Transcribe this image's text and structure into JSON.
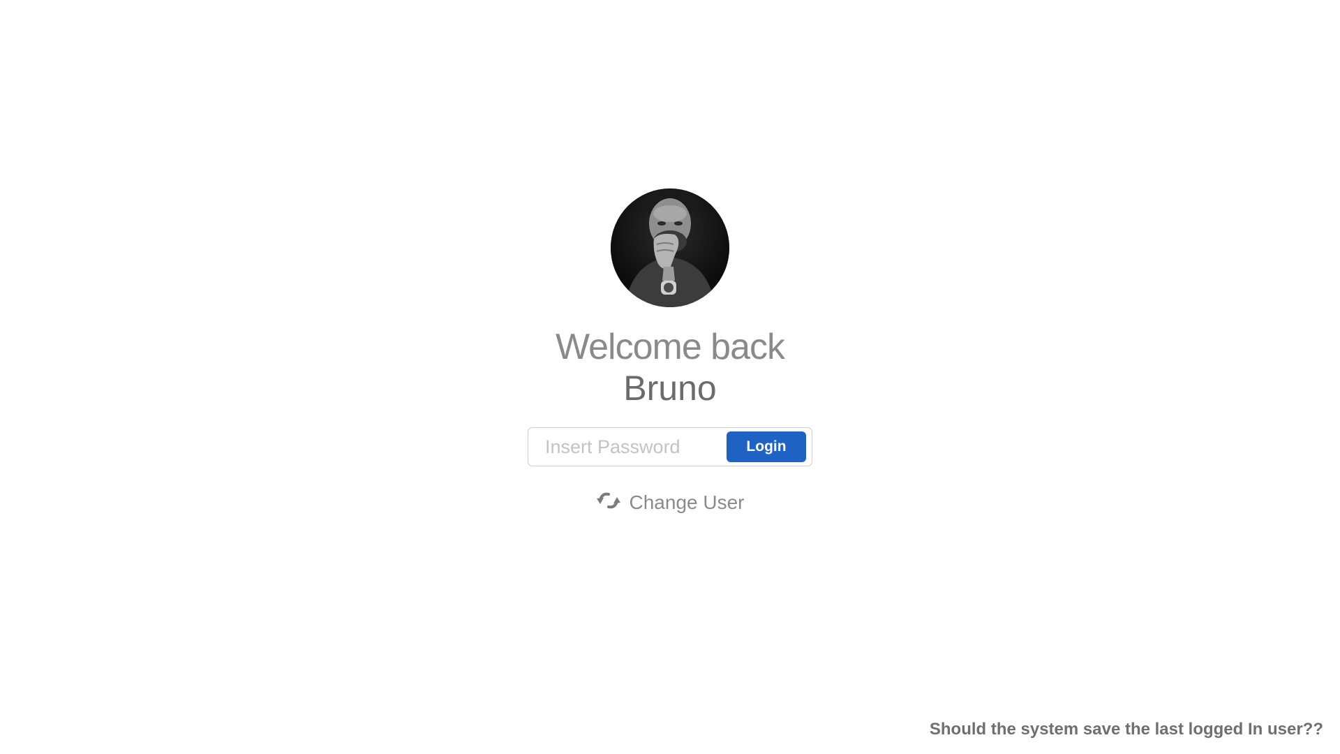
{
  "user": {
    "avatar_icon": "user-avatar-photo",
    "welcome_text": "Welcome back",
    "name": "Bruno"
  },
  "login_form": {
    "password_placeholder": "Insert Password",
    "password_value": "",
    "login_label": "Login"
  },
  "change_user": {
    "icon": "refresh-icon",
    "label": "Change User"
  },
  "footer": {
    "question": "Should the system save the last logged In user??"
  },
  "colors": {
    "accent": "#1e63c4",
    "text_gray": "#8a8a8a",
    "name_gray": "#6b6b6b"
  }
}
